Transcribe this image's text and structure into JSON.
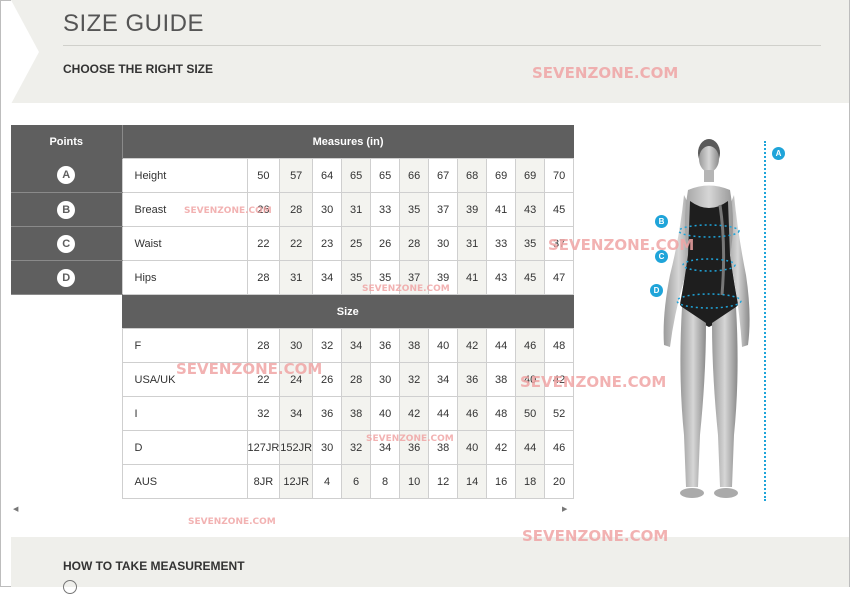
{
  "page": {
    "title": "SIZE GUIDE",
    "subtitle": "CHOOSE THE RIGHT SIZE"
  },
  "table": {
    "points_header": "Points",
    "measures_header": "Measures (in)",
    "size_header": "Size",
    "measure_rows": [
      {
        "point": "A",
        "label": "Height",
        "values": [
          "50",
          "57",
          "64",
          "65",
          "65",
          "66",
          "67",
          "68",
          "69",
          "69",
          "70"
        ]
      },
      {
        "point": "B",
        "label": "Breast",
        "values": [
          "26",
          "28",
          "30",
          "31",
          "33",
          "35",
          "37",
          "39",
          "41",
          "43",
          "45"
        ]
      },
      {
        "point": "C",
        "label": "Waist",
        "values": [
          "22",
          "22",
          "23",
          "25",
          "26",
          "28",
          "30",
          "31",
          "33",
          "35",
          "37"
        ]
      },
      {
        "point": "D",
        "label": "Hips",
        "values": [
          "28",
          "31",
          "34",
          "35",
          "35",
          "37",
          "39",
          "41",
          "43",
          "45",
          "47"
        ]
      }
    ],
    "size_rows": [
      {
        "label": "F",
        "values": [
          "28",
          "30",
          "32",
          "34",
          "36",
          "38",
          "40",
          "42",
          "44",
          "46",
          "48"
        ]
      },
      {
        "label": "USA/UK",
        "values": [
          "22",
          "24",
          "26",
          "28",
          "30",
          "32",
          "34",
          "36",
          "38",
          "40",
          "42"
        ]
      },
      {
        "label": "I",
        "values": [
          "32",
          "34",
          "36",
          "38",
          "40",
          "42",
          "44",
          "46",
          "48",
          "50",
          "52"
        ]
      },
      {
        "label": "D",
        "values": [
          "127JR",
          "152JR",
          "30",
          "32",
          "34",
          "36",
          "38",
          "40",
          "42",
          "44",
          "46"
        ]
      },
      {
        "label": "AUS",
        "values": [
          "8JR",
          "12JR",
          "4",
          "6",
          "8",
          "10",
          "12",
          "14",
          "16",
          "18",
          "20"
        ]
      }
    ]
  },
  "figure": {
    "markers": [
      "A",
      "B",
      "C",
      "D"
    ]
  },
  "footer": {
    "how_title": "HOW TO TAKE MEASUREMENT"
  },
  "watermark": {
    "text": "SEVENZONE.COM"
  },
  "colors": {
    "header_bg": "#5f5f5f",
    "band_bg": "#efefeb",
    "accent": "#1fa4d9",
    "watermark": "#f0a5a5"
  },
  "icons": {
    "scroll_left": "triangle-left-icon",
    "scroll_right": "triangle-right-icon"
  }
}
